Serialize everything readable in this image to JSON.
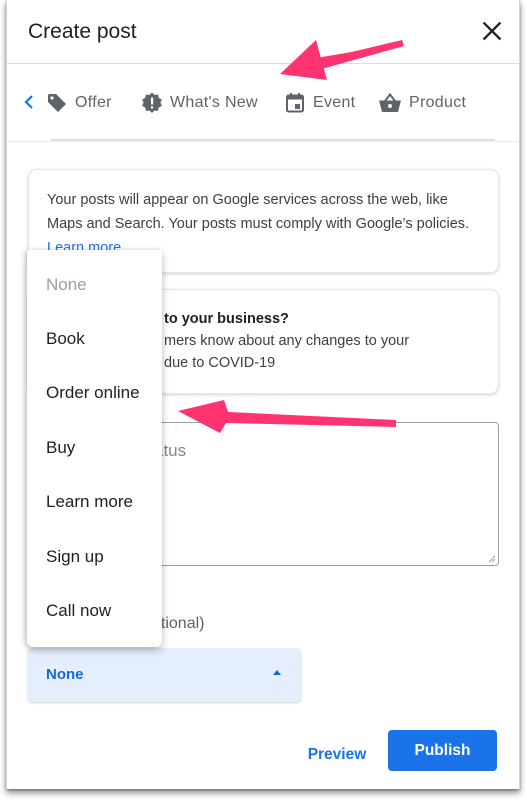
{
  "dialog": {
    "title": "Create post",
    "close_icon": "close-icon"
  },
  "tabs": {
    "back_icon": "chevron-left-icon",
    "items": [
      {
        "label": "Offer",
        "icon": "tag-icon"
      },
      {
        "label": "What's New",
        "icon": "new-releases-icon"
      },
      {
        "label": "Event",
        "icon": "calendar-icon"
      },
      {
        "label": "Product",
        "icon": "shopping-basket-icon"
      }
    ]
  },
  "policy_card": {
    "text": "Your posts will appear on Google services across the web, like Maps and Search. Your posts must comply with Google’s policies.",
    "link": "Learn more"
  },
  "covid_card": {
    "question_visible": "to your business?",
    "line2_visible": "mers know about any changes to your",
    "line3_visible": "due to COVID-19"
  },
  "post_textarea": {
    "placeholder_visible": "atus"
  },
  "button_section": {
    "label_visible": "ptional)",
    "selected_value": "None"
  },
  "dropdown_menu": {
    "options": [
      "None",
      "Book",
      "Order online",
      "Buy",
      "Learn more",
      "Sign up",
      "Call now"
    ]
  },
  "footer": {
    "preview_label": "Preview",
    "publish_label": "Publish"
  },
  "colors": {
    "accent": "#1a73e8",
    "select_bg": "#e5eefc",
    "annotation_arrow": "#ff3370"
  }
}
